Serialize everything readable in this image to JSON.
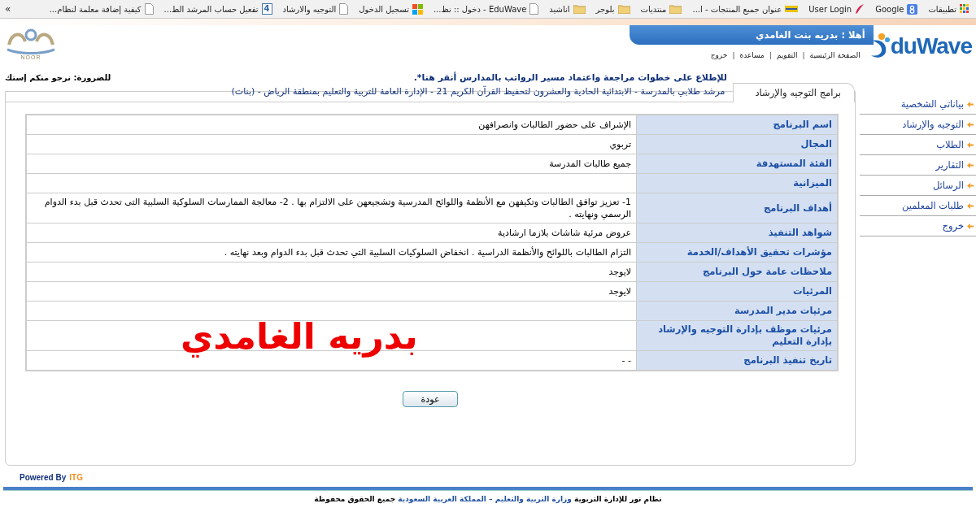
{
  "bookmarks": [
    {
      "kind": "apps",
      "label": "تطبيقات"
    },
    {
      "kind": "google",
      "label": "Google"
    },
    {
      "kind": "feather",
      "label": "User Login"
    },
    {
      "kind": "card",
      "label": "عنوان جميع المنتجات - ا..."
    },
    {
      "kind": "folder",
      "label": "منتديات"
    },
    {
      "kind": "folder",
      "label": "بلوجر"
    },
    {
      "kind": "folder",
      "label": "اناشيد"
    },
    {
      "kind": "page",
      "label": "EduWave - دخول :: نظ..."
    },
    {
      "kind": "windows",
      "label": "تسجيل الدخول"
    },
    {
      "kind": "page",
      "label": "التوجيه والارشاد"
    },
    {
      "kind": "badge",
      "badge": "4",
      "label": "تفعيل حساب المرشد الط..."
    },
    {
      "kind": "page",
      "label": "كيفية إضافة معلمة لنظام..."
    }
  ],
  "bookmarks_more": "»",
  "header": {
    "logo_text": "duWave",
    "greeting": "أهلا : بدريه بنت الغامدي",
    "nav": [
      "الصفحة الرئيسية",
      "التقويم",
      "مساعدة",
      "خروج"
    ],
    "nav_separator": "|",
    "noor_logo": "NOOR"
  },
  "notice": {
    "link": "للإطلاع على خطوات مراجعة واعتماد مسير الرواتب بالمدارس أنقر هنا*.",
    "urgent": "للضرورة: نرجو منكم إستك"
  },
  "sidebar": {
    "items": [
      "بياناتي الشخصية",
      "التوجيه والإرشاد",
      "الطلاب",
      "التقارير",
      "الرسائل",
      "طلبات المعلمين",
      "خروج"
    ]
  },
  "tab": {
    "label": "برامج التوجيه والإرشاد",
    "subtitle": "مرشد طلابي بالمدرسة - الابتدائية الحادية والعشرون لتحفيظ القرآن الكريم 21 - الإدارة العامة للتربية والتعليم بمنطقة الرياض - (بنات)"
  },
  "table": {
    "rows": [
      {
        "label": "اسم البرنامج",
        "value": "الإشراف على حضور الطالبات وانصرافهن"
      },
      {
        "label": "المجال",
        "value": "تربوي"
      },
      {
        "label": "الفئة المستهدفة",
        "value": "جميع طالبات المدرسة"
      },
      {
        "label": "الميزانية"
      },
      {
        "label": "أهداف البرنامج",
        "value": "1- تعزيز توافق الطالبات وتكيفهن مع الأنظمة واللوائح المدرسية وتشجيعهن على الالتزام بها . 2- معالجة الممارسات السلوكية السلبية التى تحدث قبل بدء الدوام الرسمي ونهايته ."
      },
      {
        "label": "شواهد التنفيذ",
        "value": "عروض مرئية شاشات بلازما ارشادية"
      },
      {
        "label": "مؤشرات تحقيق الأهداف/الخدمة",
        "value": "التزام الطالبات باللوائح والأنظمة الدراسية . انخفاض السلوكيات السلبية التي تحدث قبل بدء الدوام وبعد نهايته ."
      },
      {
        "label": "ملاحظات عامة حول البرنامج",
        "value": "لايوجد"
      },
      {
        "label": "المرئيات",
        "value": "لايوجد"
      },
      {
        "label": "مرئيات مدير المدرسة"
      },
      {
        "label": "مرئيات موظف بإدارة التوجيه والإرشاد بإدارة التعليم"
      },
      {
        "label": "تاريخ تنفيذ البرنامج",
        "value": "- -"
      }
    ]
  },
  "overlay_text": "بدريه الغامدي",
  "back_button": "عودة",
  "powered_by": {
    "label": "Powered By",
    "brand": "ITG"
  },
  "footer": [
    {
      "text": "نظام نور للإدارة التربوية ",
      "kind": "plain"
    },
    {
      "text": "وزارة التربية والتعليم – المملكة العربية السعودية",
      "kind": "link"
    },
    {
      "text": " جميع الحقوق محفوظة",
      "kind": "plain"
    }
  ]
}
